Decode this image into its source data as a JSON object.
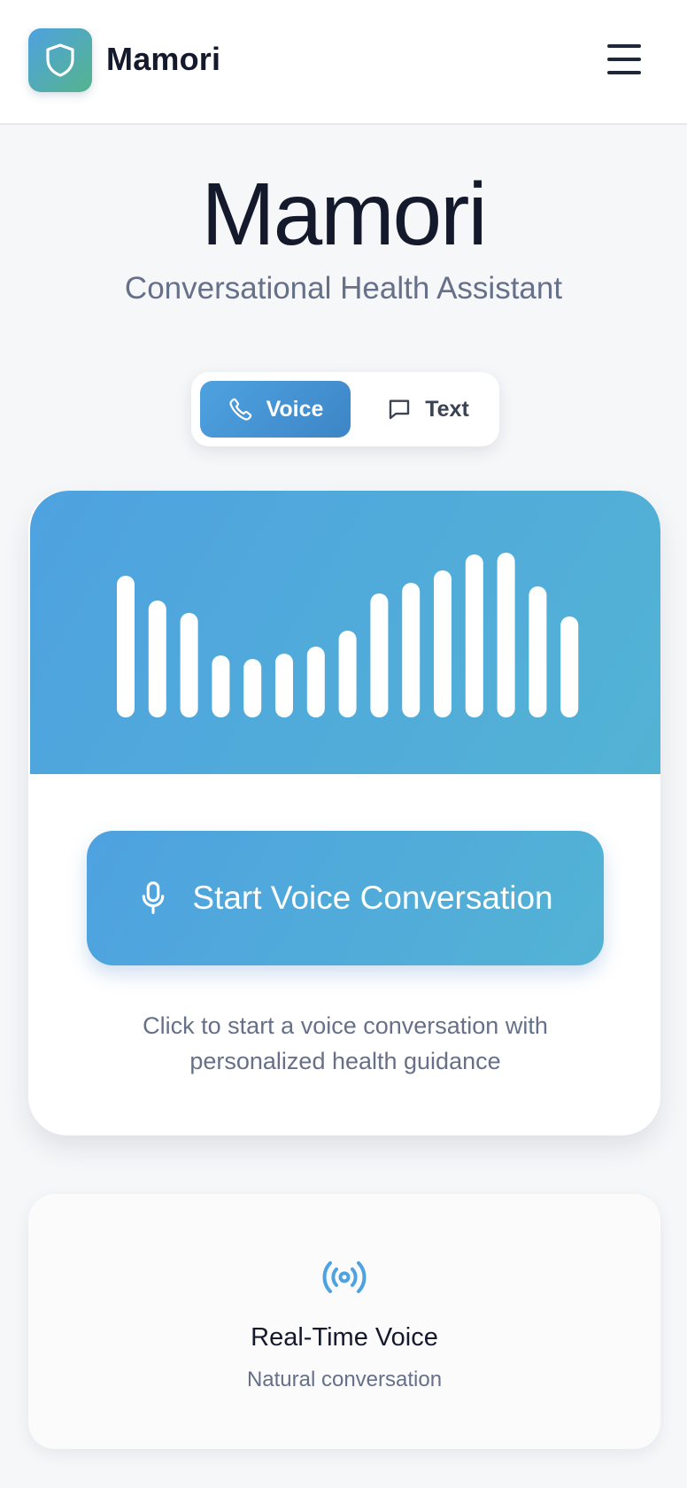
{
  "header": {
    "brand": "Mamori",
    "logo_icon": "shield-icon",
    "menu_icon": "hamburger-menu-icon"
  },
  "hero": {
    "title": "Mamori",
    "subtitle": "Conversational Health Assistant"
  },
  "mode_toggle": {
    "selected": "Voice",
    "voice_label": "Voice",
    "voice_icon": "phone-icon",
    "text_label": "Text",
    "text_icon": "chat-bubble-icon"
  },
  "voice_card": {
    "waveform_levels": [
      0.8,
      0.66,
      0.59,
      0.35,
      0.33,
      0.36,
      0.4,
      0.49,
      0.7,
      0.76,
      0.83,
      0.92,
      0.93,
      0.74,
      0.57
    ],
    "start_button_label": "Start Voice Conversation",
    "start_button_icon": "microphone-icon",
    "hint": "Click to start a voice conversation with personalized health guidance"
  },
  "feature": {
    "icon": "broadcast-icon",
    "title": "Real-Time Voice",
    "subtitle": "Natural conversation"
  },
  "colors": {
    "accent_blue": "#4ea2e0",
    "accent_teal": "#53b3d4",
    "logo_green": "#55b48c",
    "text_dark": "#141a2c",
    "text_muted": "#667089"
  }
}
